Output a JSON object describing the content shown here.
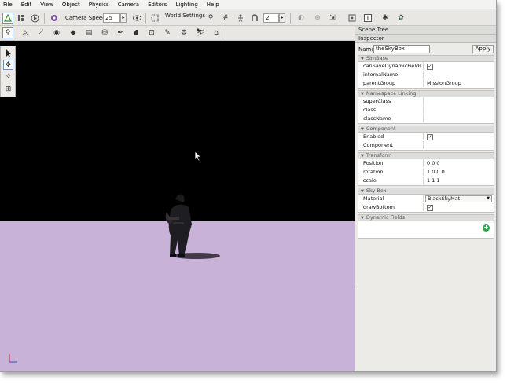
{
  "menu": [
    "File",
    "Edit",
    "View",
    "Object",
    "Physics",
    "Camera",
    "Editors",
    "Lighting",
    "Help"
  ],
  "toolbar": {
    "camera_speed_label": "Camera Speed",
    "camera_speed_value": "25",
    "world_settings_label": "World Settings",
    "grid_value": "2"
  },
  "scene_tree": {
    "title": "Scene Tree"
  },
  "inspector": {
    "title": "Inspector",
    "name_label": "Name:",
    "name_value": "theSkyBox",
    "apply_label": "Apply",
    "sections": {
      "simbase": {
        "title": "SimBase",
        "props": [
          {
            "name": "canSaveDynamicFields",
            "value": "✓"
          },
          {
            "name": "internalName",
            "value": ""
          },
          {
            "name": "parentGroup",
            "value": "MissionGroup"
          }
        ]
      },
      "namespace": {
        "title": "Namespace Linking",
        "props": [
          {
            "name": "superClass",
            "value": ""
          },
          {
            "name": "class",
            "value": ""
          },
          {
            "name": "className",
            "value": ""
          }
        ]
      },
      "component": {
        "title": "Component",
        "props": [
          {
            "name": "Enabled",
            "value": "✓"
          },
          {
            "name": "Component",
            "value": ""
          }
        ]
      },
      "transform": {
        "title": "Transform",
        "props": [
          {
            "name": "Position",
            "value": "0 0 0"
          },
          {
            "name": "rotation",
            "value": "1 0 0 0"
          },
          {
            "name": "scale",
            "value": "1 1 1"
          }
        ]
      },
      "skybox": {
        "title": "Sky Box",
        "props": [
          {
            "name": "Material",
            "value": "BlackSkyMat"
          },
          {
            "name": "drawBottom",
            "value": "✓"
          }
        ]
      },
      "dynamic": {
        "title": "Dynamic Fields"
      }
    }
  },
  "colors": {
    "sky": "#000000",
    "ground": "#c9b2d8",
    "accent": "#6f8fb8"
  }
}
